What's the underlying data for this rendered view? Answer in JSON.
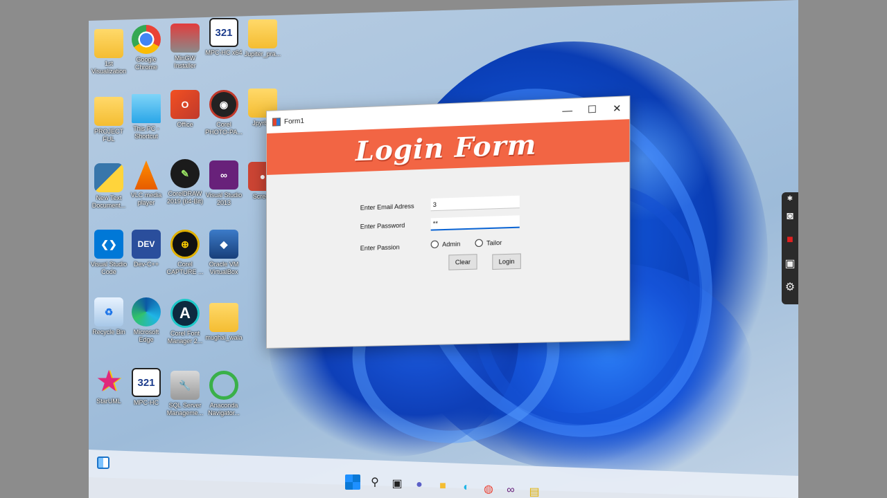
{
  "desktop_icons": [
    {
      "label": "1st Visualization",
      "icon": "folder-icon"
    },
    {
      "label": "Google Chrome",
      "icon": "chrome-icon"
    },
    {
      "label": "MinGW Installer",
      "icon": "mingw-icon"
    },
    {
      "label": "MPC-HC x64",
      "icon": "mpc-hc-icon"
    },
    {
      "label": "Jupiter_pra...",
      "icon": "folder-icon"
    },
    {
      "label": "PROJECT FUL",
      "icon": "folder-icon"
    },
    {
      "label": "This PC - Shortcut",
      "icon": "this-pc-icon"
    },
    {
      "label": "Office",
      "icon": "office-icon"
    },
    {
      "label": "Corel PHOTO-PA...",
      "icon": "corel-photo-paint-icon"
    },
    {
      "label": "Jpyrb...",
      "icon": "folder-icon"
    },
    {
      "label": "New Text Document...",
      "icon": "python-file-icon"
    },
    {
      "label": "VLC media player",
      "icon": "vlc-icon"
    },
    {
      "label": "CorelDRAW 2019 (64-Bit)",
      "icon": "coreldraw-icon"
    },
    {
      "label": "Visual Studio 2013",
      "icon": "visual-studio-icon"
    },
    {
      "label": "Screen",
      "icon": "screen-recorder-icon"
    },
    {
      "label": "Visual Studio Code",
      "icon": "vscode-icon"
    },
    {
      "label": "Dev-C++",
      "icon": "devcpp-icon"
    },
    {
      "label": "Corel CAPTURE ...",
      "icon": "corel-capture-icon"
    },
    {
      "label": "Oracle VM VirtualBox",
      "icon": "virtualbox-icon"
    },
    {
      "label": "Recycle Bin",
      "icon": "recycle-bin-icon"
    },
    {
      "label": "Microsoft Edge",
      "icon": "edge-icon"
    },
    {
      "label": "Corel Font Manager 2...",
      "icon": "corel-font-manager-icon"
    },
    {
      "label": "mughal_wala",
      "icon": "folder-icon"
    },
    {
      "label": "StarUML",
      "icon": "staruml-icon"
    },
    {
      "label": "MPC-HC",
      "icon": "mpc-hc-icon"
    },
    {
      "label": "SQL Server Manageme...",
      "icon": "sql-server-icon"
    },
    {
      "label": "Anaconda Navigator...",
      "icon": "anaconda-icon"
    }
  ],
  "window": {
    "title": "Form1",
    "minimize_glyph": "—",
    "maximize_glyph": "☐",
    "close_glyph": "✕"
  },
  "form": {
    "banner_title": "Login Form",
    "email_label": "Enter Email Adress",
    "email_value": "3",
    "password_label": "Enter Password",
    "password_value": "**",
    "passion_label": "Enter Passion",
    "radio_admin": "Admin",
    "radio_tailor": "Tailor",
    "clear_button": "Clear",
    "login_button": "Login"
  },
  "toolbar_icons": [
    "pin-icon",
    "camera-icon",
    "record-icon",
    "gallery-icon",
    "settings-icon"
  ],
  "taskbar_icons": [
    "start-icon",
    "search-icon",
    "task-view-icon",
    "chat-icon",
    "file-explorer-icon",
    "edge-icon",
    "chrome-icon",
    "visual-studio-icon",
    "app-icon"
  ],
  "colors": {
    "banner": "#f26544",
    "focus_underline": "#0a64d4",
    "wallpaper_bloom": "#0f4fd1"
  }
}
